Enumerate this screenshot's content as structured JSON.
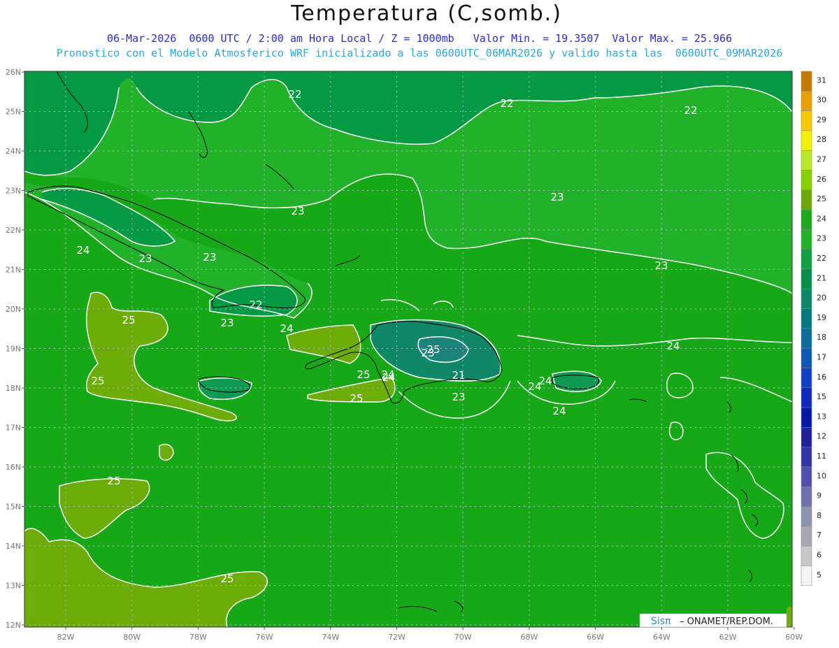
{
  "header": {
    "title": "Temperatura (C,somb.)",
    "subtitle_1": "06-Mar-2026  0600 UTC / 2:00 am Hora Local / Z = 1000mb   Valor Min. = 19.3507  Valor Max. = 25.966",
    "subtitle_2": "Pronostico con el Modelo Atmosferico WRF inicializado a las 0600UTC_06MAR2026 y valido hasta las  0600UTC_09MAR2026"
  },
  "map": {
    "lat_labels": [
      "26N",
      "25N",
      "24N",
      "23N",
      "22N",
      "21N",
      "20N",
      "19N",
      "18N",
      "17N",
      "16N",
      "15N",
      "14N",
      "13N",
      "12N"
    ],
    "lon_labels": [
      "82W",
      "80W",
      "78W",
      "76W",
      "74W",
      "72W",
      "70W",
      "68W",
      "66W",
      "64W",
      "62W",
      "60W"
    ],
    "contour_labels": [
      "22",
      "22",
      "22",
      "23",
      "23",
      "23",
      "23",
      "23",
      "24",
      "24",
      "24",
      "24",
      "24",
      "25",
      "25",
      "25",
      "25",
      "25",
      "23",
      "21",
      "22",
      "23",
      "24",
      "23",
      "24",
      "25",
      "24",
      "25"
    ],
    "colors": {
      "bg_24": "#16a816",
      "band_25": "#6cad08",
      "band_23": "#22b22a",
      "band_22": "#049a44",
      "band_21": "#1e8a5a",
      "contour": "#ffffff",
      "grid": "#b0b0d0",
      "coast": "#000000"
    }
  },
  "colorbar": {
    "labels": [
      "31",
      "30",
      "29",
      "28",
      "27",
      "26",
      "25",
      "24",
      "23",
      "22",
      "21",
      "20",
      "19",
      "18",
      "17",
      "16",
      "15",
      "13",
      "12",
      "11",
      "10",
      "9",
      "8",
      "7",
      "6",
      "5"
    ],
    "colors": [
      "#c87800",
      "#e8a000",
      "#f8c800",
      "#f0f000",
      "#b8e828",
      "#88d000",
      "#6aa808",
      "#1ea81e",
      "#22b22a",
      "#10a040",
      "#04904a",
      "#108868",
      "#087880",
      "#0e6c9a",
      "#1058b8",
      "#1040c8",
      "#0c28c0",
      "#0818a8",
      "#202098",
      "#3434a8",
      "#5050b0",
      "#7070b0",
      "#9090b0",
      "#a8a8b0",
      "#c8c8c8",
      "#f4f4f4"
    ]
  },
  "watermark": {
    "brand": "Sisπ",
    "text": "– ONAMET/REP.DOM."
  }
}
